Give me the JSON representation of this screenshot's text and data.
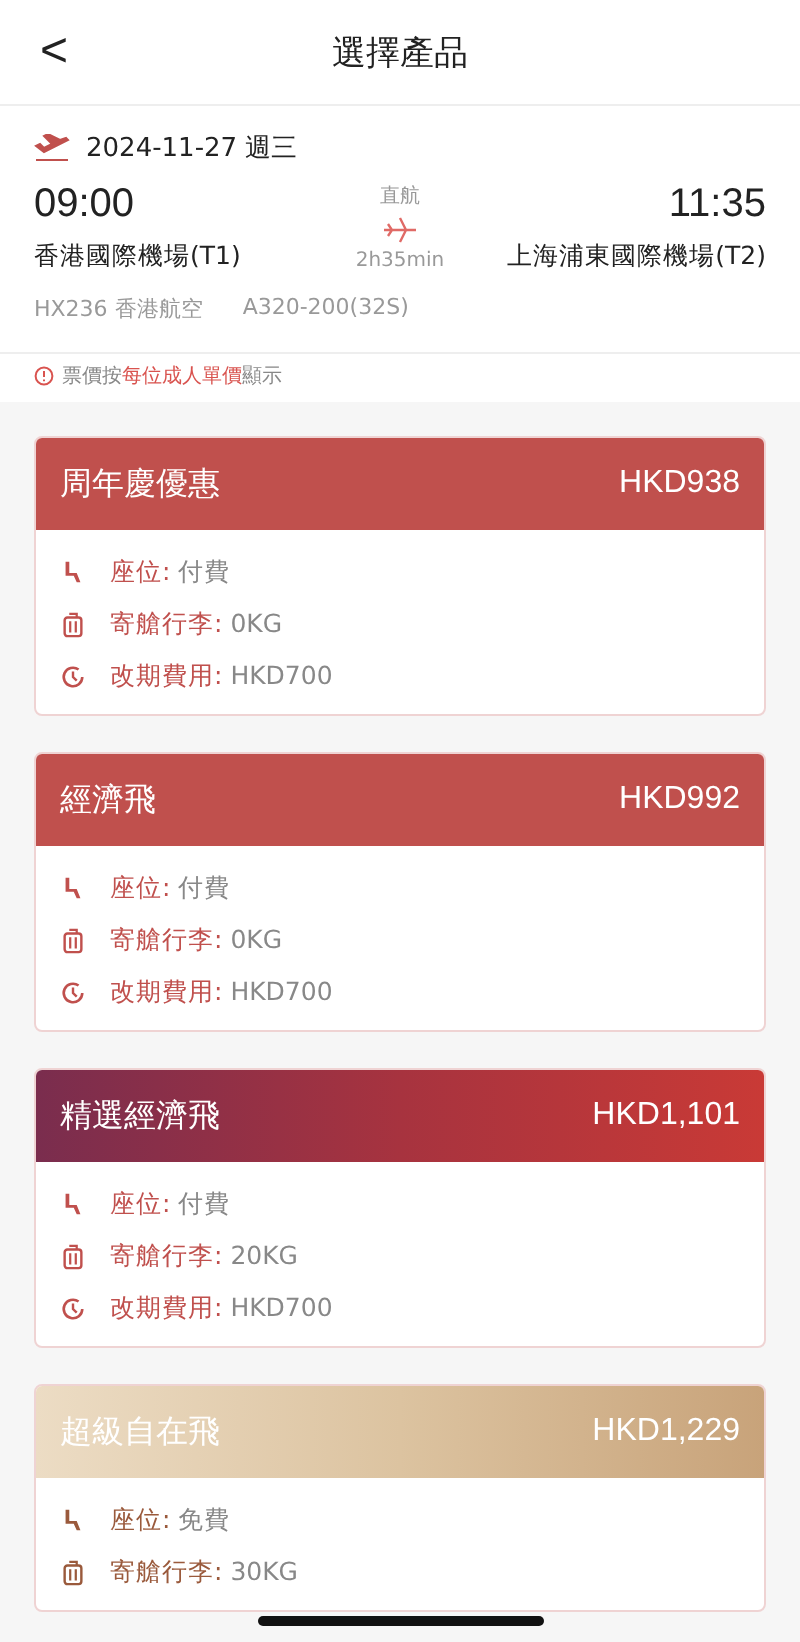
{
  "header": {
    "title": "選擇產品",
    "back": "<"
  },
  "flight": {
    "date": "2024-11-27 週三",
    "depart_time": "09:00",
    "depart_airport": "香港國際機場(T1)",
    "type": "直航",
    "duration": "2h35min",
    "arrive_time": "11:35",
    "arrive_airport": "上海浦東國際機場(T2)",
    "flight_no": "HX236 香港航空",
    "aircraft": "A320-200(32S)"
  },
  "note": "票價按**每位成人單價**顯示",
  "products": [
    {
      "name": "周年慶優惠",
      "price": "HKD938",
      "kind": "standard",
      "features": [
        {
          "kind": "seat",
          "label": "座位:",
          "value": "付費"
        },
        {
          "kind": "baggage",
          "label": "寄艙行李:",
          "value": "0KG"
        },
        {
          "kind": "change",
          "label": "改期費用:",
          "value": "HKD700"
        }
      ]
    },
    {
      "name": "經濟飛",
      "price": "HKD992",
      "kind": "standard",
      "features": [
        {
          "kind": "seat",
          "label": "座位:",
          "value": "付費"
        },
        {
          "kind": "baggage",
          "label": "寄艙行李:",
          "value": "0KG"
        },
        {
          "kind": "change",
          "label": "改期費用:",
          "value": "HKD700"
        }
      ]
    },
    {
      "name": "精選經濟飛",
      "price": "HKD1,101",
      "kind": "premium",
      "features": [
        {
          "kind": "seat",
          "label": "座位:",
          "value": "付費"
        },
        {
          "kind": "baggage",
          "label": "寄艙行李:",
          "value": "20KG"
        },
        {
          "kind": "change",
          "label": "改期費用:",
          "value": "HKD700"
        }
      ]
    },
    {
      "name": "超級自在飛",
      "price": "HKD1,229",
      "kind": "luxury",
      "features": [
        {
          "kind": "seat",
          "label": "座位:",
          "value": "免費"
        },
        {
          "kind": "baggage",
          "label": "寄艙行李:",
          "value": "30KG"
        }
      ]
    }
  ]
}
